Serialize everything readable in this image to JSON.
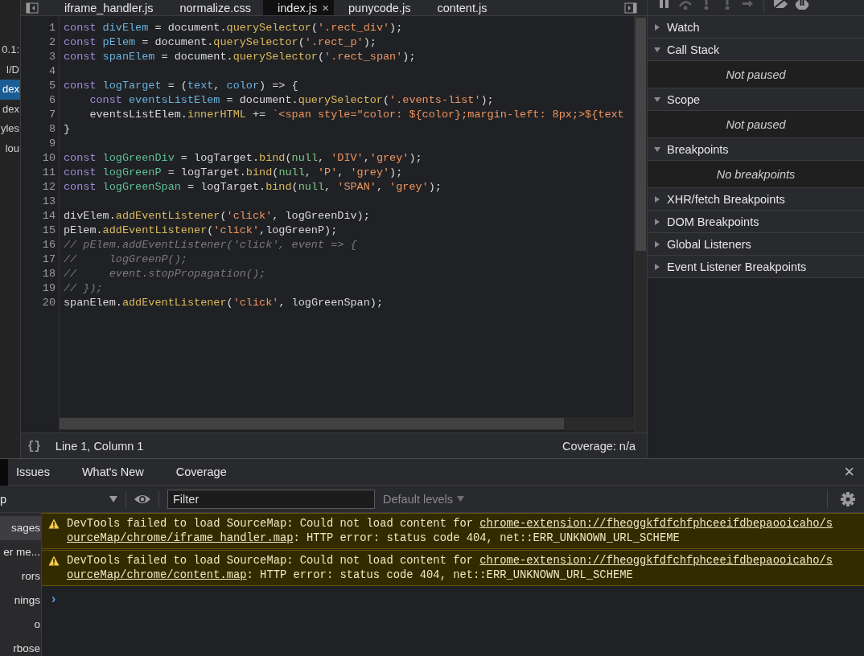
{
  "navigator": {
    "items": [
      {
        "label": "0.1:",
        "selected": false
      },
      {
        "label": "l/D",
        "selected": false
      },
      {
        "label": "dex",
        "selected": true
      },
      {
        "label": "dex",
        "selected": false
      },
      {
        "label": "yles",
        "selected": false
      },
      {
        "label": "lou",
        "selected": false
      }
    ]
  },
  "editor": {
    "tabs": [
      {
        "label": "iframe_handler.js",
        "selected": false
      },
      {
        "label": "normalize.css",
        "selected": false
      },
      {
        "label": "index.js",
        "selected": true,
        "close": "×"
      },
      {
        "label": "punycode.js",
        "selected": false
      },
      {
        "label": "content.js",
        "selected": false
      }
    ],
    "lines": [
      {
        "number": "1",
        "tokens": [
          {
            "kind": "kw",
            "text": "const"
          },
          {
            "kind": "def",
            "text": " divElem"
          },
          {
            "kind": "p",
            "text": " = document."
          },
          {
            "kind": "prop",
            "text": "querySelector"
          },
          {
            "kind": "p",
            "text": "("
          },
          {
            "kind": "str",
            "text": "'.rect_div'"
          },
          {
            "kind": "p",
            "text": ");"
          }
        ]
      },
      {
        "number": "2",
        "tokens": [
          {
            "kind": "kw",
            "text": "const"
          },
          {
            "kind": "def",
            "text": " pElem"
          },
          {
            "kind": "p",
            "text": " = document."
          },
          {
            "kind": "prop",
            "text": "querySelector"
          },
          {
            "kind": "p",
            "text": "("
          },
          {
            "kind": "str",
            "text": "'.rect_p'"
          },
          {
            "kind": "p",
            "text": ");"
          }
        ]
      },
      {
        "number": "3",
        "tokens": [
          {
            "kind": "kw",
            "text": "const"
          },
          {
            "kind": "def",
            "text": " spanElem"
          },
          {
            "kind": "p",
            "text": " = document."
          },
          {
            "kind": "prop",
            "text": "querySelector"
          },
          {
            "kind": "p",
            "text": "("
          },
          {
            "kind": "str",
            "text": "'.rect_span'"
          },
          {
            "kind": "p",
            "text": ");"
          }
        ]
      },
      {
        "number": "4"
      },
      {
        "number": "5",
        "tokens": [
          {
            "kind": "kw",
            "text": "const"
          },
          {
            "kind": "def",
            "text": " logTarget"
          },
          {
            "kind": "p",
            "text": " = ("
          },
          {
            "kind": "def",
            "text": "text"
          },
          {
            "kind": "p",
            "text": ", "
          },
          {
            "kind": "def",
            "text": "color"
          },
          {
            "kind": "p",
            "text": ") => {"
          }
        ]
      },
      {
        "number": "6",
        "indent": true,
        "tokens": [
          {
            "kind": "kw",
            "text": "const"
          },
          {
            "kind": "def",
            "text": " eventsListElem"
          },
          {
            "kind": "p",
            "text": " = document."
          },
          {
            "kind": "prop",
            "text": "querySelector"
          },
          {
            "kind": "p",
            "text": "("
          },
          {
            "kind": "str",
            "text": "'.events-list'"
          },
          {
            "kind": "p",
            "text": ");"
          }
        ]
      },
      {
        "number": "7",
        "indent": true,
        "tokens": [
          {
            "kind": "p",
            "text": "eventsListElem."
          },
          {
            "kind": "prop",
            "text": "innerHTML"
          },
          {
            "kind": "p",
            "text": " += "
          },
          {
            "kind": "str",
            "text": "`<span style=\"color: ${color};margin-left: 8px;>${text"
          }
        ]
      },
      {
        "number": "8",
        "tokens": [
          {
            "kind": "p",
            "text": "}"
          }
        ]
      },
      {
        "number": "9"
      },
      {
        "number": "10",
        "tokens": [
          {
            "kind": "kw",
            "text": "const"
          },
          {
            "kind": "fn",
            "text": " logGreenDiv"
          },
          {
            "kind": "p",
            "text": " = logTarget."
          },
          {
            "kind": "prop",
            "text": "bind"
          },
          {
            "kind": "p",
            "text": "("
          },
          {
            "kind": "atom",
            "text": "null"
          },
          {
            "kind": "p",
            "text": ", "
          },
          {
            "kind": "str",
            "text": "'DIV'"
          },
          {
            "kind": "p",
            "text": ","
          },
          {
            "kind": "str",
            "text": "'grey'"
          },
          {
            "kind": "p",
            "text": ");"
          }
        ]
      },
      {
        "number": "11",
        "tokens": [
          {
            "kind": "kw",
            "text": "const"
          },
          {
            "kind": "fn",
            "text": " logGreenP"
          },
          {
            "kind": "p",
            "text": " = logTarget."
          },
          {
            "kind": "prop",
            "text": "bind"
          },
          {
            "kind": "p",
            "text": "("
          },
          {
            "kind": "atom",
            "text": "null"
          },
          {
            "kind": "p",
            "text": ", "
          },
          {
            "kind": "str",
            "text": "'P'"
          },
          {
            "kind": "p",
            "text": ", "
          },
          {
            "kind": "str",
            "text": "'grey'"
          },
          {
            "kind": "p",
            "text": ");"
          }
        ]
      },
      {
        "number": "12",
        "tokens": [
          {
            "kind": "kw",
            "text": "const"
          },
          {
            "kind": "fn",
            "text": " logGreenSpan"
          },
          {
            "kind": "p",
            "text": " = logTarget."
          },
          {
            "kind": "prop",
            "text": "bind"
          },
          {
            "kind": "p",
            "text": "("
          },
          {
            "kind": "atom",
            "text": "null"
          },
          {
            "kind": "p",
            "text": ", "
          },
          {
            "kind": "str",
            "text": "'SPAN'"
          },
          {
            "kind": "p",
            "text": ", "
          },
          {
            "kind": "str",
            "text": "'grey'"
          },
          {
            "kind": "p",
            "text": ");"
          }
        ]
      },
      {
        "number": "13"
      },
      {
        "number": "14",
        "tokens": [
          {
            "kind": "p",
            "text": "divElem."
          },
          {
            "kind": "prop",
            "text": "addEventListener"
          },
          {
            "kind": "p",
            "text": "("
          },
          {
            "kind": "str",
            "text": "'click'"
          },
          {
            "kind": "p",
            "text": ", logGreenDiv);"
          }
        ]
      },
      {
        "number": "15",
        "tokens": [
          {
            "kind": "p",
            "text": "pElem."
          },
          {
            "kind": "prop",
            "text": "addEventListener"
          },
          {
            "kind": "p",
            "text": "("
          },
          {
            "kind": "str",
            "text": "'click'"
          },
          {
            "kind": "p",
            "text": ",logGreenP);"
          }
        ]
      },
      {
        "number": "16",
        "tokens": [
          {
            "kind": "com",
            "text": "// pElem.addEventListener('click', event => {"
          }
        ]
      },
      {
        "number": "17",
        "tokens": [
          {
            "kind": "com",
            "text": "//     logGreenP();"
          }
        ]
      },
      {
        "number": "18",
        "tokens": [
          {
            "kind": "com",
            "text": "//     event.stopPropagation();"
          }
        ]
      },
      {
        "number": "19",
        "tokens": [
          {
            "kind": "com",
            "text": "// });"
          }
        ]
      },
      {
        "number": "20",
        "tokens": [
          {
            "kind": "p",
            "text": "spanElem."
          },
          {
            "kind": "prop",
            "text": "addEventListener"
          },
          {
            "kind": "p",
            "text": "("
          },
          {
            "kind": "str",
            "text": "'click'"
          },
          {
            "kind": "p",
            "text": ", logGreenSpan);"
          }
        ]
      }
    ],
    "status_bar": {
      "pretty_print": "{}",
      "position": "Line 1, Column 1",
      "coverage": "Coverage: n/a"
    }
  },
  "debugger": {
    "sections": [
      {
        "title": "Watch",
        "expanded": false
      },
      {
        "title": "Call Stack",
        "expanded": true,
        "body": "Not paused"
      },
      {
        "title": "Scope",
        "expanded": true,
        "body": "Not paused"
      },
      {
        "title": "Breakpoints",
        "expanded": true,
        "body": "No breakpoints"
      },
      {
        "title": "XHR/fetch Breakpoints",
        "expanded": false
      },
      {
        "title": "DOM Breakpoints",
        "expanded": false
      },
      {
        "title": "Global Listeners",
        "expanded": false
      },
      {
        "title": "Event Listener Breakpoints",
        "expanded": false
      }
    ]
  },
  "drawer": {
    "tabs": [
      {
        "label": "Issues",
        "selected": false
      },
      {
        "label": "What's New",
        "selected": false
      },
      {
        "label": "Coverage",
        "selected": false
      }
    ],
    "close": "×",
    "toolbar": {
      "context": "p",
      "filter": {
        "placeholder": "Filter"
      },
      "levels": "Default levels"
    },
    "sidebar": [
      {
        "label": "sages",
        "selected": true
      },
      {
        "label": "er me...",
        "selected": false
      },
      {
        "label": "rors",
        "selected": false
      },
      {
        "label": "nings",
        "selected": false
      },
      {
        "label": "o",
        "selected": false
      },
      {
        "label": "rbose",
        "selected": false
      }
    ],
    "messages": [
      {
        "kind": "warning",
        "text": "DevTools failed to load SourceMap: Could not load content for ",
        "link": "chrome-extension://fheoggkfdfchfphceeifdbepaooicaho/sourceMap/chrome/iframe_handler.map",
        "after": ": HTTP error: status code 404, net::ERR_UNKNOWN_URL_SCHEME"
      },
      {
        "kind": "warning",
        "text": "DevTools failed to load SourceMap: Could not load content for ",
        "link": "chrome-extension://fheoggkfdfchfphceeifdbepaooicaho/sourceMap/chrome/content.map",
        "after": ": HTTP error: status code 404, net::ERR_UNKNOWN_URL_SCHEME"
      }
    ],
    "prompt": "›"
  }
}
